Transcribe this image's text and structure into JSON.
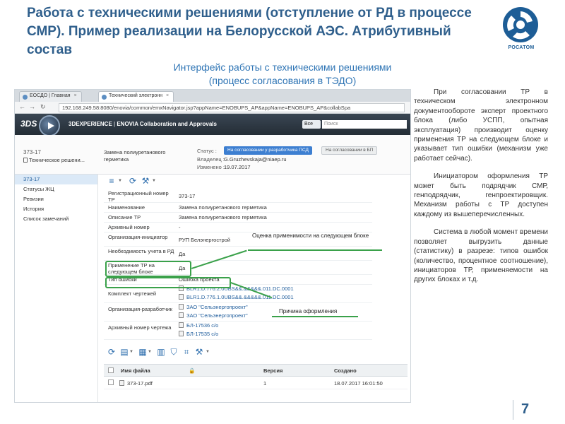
{
  "slide": {
    "title": "Работа с техническими решениями (отступление от РД в процессе СМР). Пример реализации на Белорусской АЭС. Атрибутивный состав",
    "subtitle_line1": "Интерфейс работы с техническими решениями",
    "subtitle_line2": "(процесс согласования в ТЭДО)",
    "logo_text": "РОСАТОМ",
    "page_number": "7",
    "brand_color": "#1d5d96"
  },
  "browser": {
    "tabs": [
      {
        "label": "ЕОСДО | Главная"
      },
      {
        "label": "Технический электронн"
      }
    ],
    "close_glyph": "×",
    "url": "192.168.249.58:8080/enovia/common/emxNavigator.jsp?appName=ENOBUPS_AP&appName=ENOBUPS_AP&collabSpa"
  },
  "app": {
    "ds_logo": "3DS",
    "brand": "3DEXPERIENCE",
    "module": "ENOVIA Collaboration and Approvals",
    "scope_label": "Все",
    "search_placeholder": "Поиск"
  },
  "object_header": {
    "name": "373-17",
    "type": "Техническое решени...",
    "description": "Замена полиуретанового герметика",
    "status_label": "Статус :",
    "status_value": "На согласовании у разработчика ПСД",
    "next_status": "На согласовании в БП",
    "owner_label": "Владелец :",
    "owner_value": "G.Gruzhevskaja@niaep.ru",
    "modified_label": "Изменено :",
    "modified_value": "19.07.2017"
  },
  "sidebar": {
    "items": [
      {
        "label": "373-17"
      },
      {
        "label": "Статусы ЖЦ"
      },
      {
        "label": "Ревизии"
      },
      {
        "label": "История"
      },
      {
        "label": "Список замечаний"
      }
    ]
  },
  "properties": [
    {
      "label": "Регистрационный номер ТР",
      "value": "373-17"
    },
    {
      "label": "Наименование",
      "value": "Замена полиуретанового герметика"
    },
    {
      "label": "Описание ТР",
      "value": "Замена полиуретанового герметика"
    },
    {
      "label": "Архивный номер",
      "value": "-"
    },
    {
      "label": "Организация-инициатор",
      "value": "РУП Белэнергострой"
    },
    {
      "label": "Необходимость учета в РД",
      "value": "Да"
    },
    {
      "label": "Применение ТР на следующем блоке",
      "value": "Да"
    },
    {
      "label": "Тип ошибки",
      "value": "Ошибка проекта"
    },
    {
      "label": "Комплект чертежей",
      "values": [
        "BLR1.D.776.2.0UBS&&.&&&&&.011.DC.0001",
        "BLR1.D.776.1.0UBS&&.&&&&&.011.DC.0001"
      ]
    },
    {
      "label": "Организация-разработчик",
      "values": [
        "ЗАО \"Сельэнергопроект\"",
        "ЗАО \"Сельэнергопроект\""
      ]
    },
    {
      "label": "Архивный номер чертежа",
      "values": [
        "БЛ-17536 с/о",
        "БЛ-17535 с/о"
      ]
    }
  ],
  "files_table": {
    "headers": [
      "Имя файла",
      "Версия",
      "Создано"
    ],
    "rows": [
      {
        "name": "373-17.pdf",
        "version": "1",
        "created": "18.07.2017 16:01:50"
      }
    ]
  },
  "callouts": {
    "applicability": "Оценка применимости на следующем блоке",
    "reason": "Причина оформления",
    "highlight_color": "#3aa14a"
  },
  "right_text": {
    "p1": "При согласовании ТР в техническом электронном документообороте эксперт проектного блока (либо УСПП, опытная эксплуатация) производит оценку применения ТР на следующем блоке и указывает тип ошибки (механизм уже работает сейчас).",
    "p2": "Инициатором оформления ТР может быть подрядчик СМР, генподрядчик, генпроектировщик. Механизм работы с ТР доступен каждому из вышеперечисленных.",
    "p3": "Система в любой момент времени позволяет выгрузить данные (статистику) в разрезе: типов ошибок (количество, процентное соотношение), инициаторов ТР, применяемости на других блоках и т.д."
  }
}
